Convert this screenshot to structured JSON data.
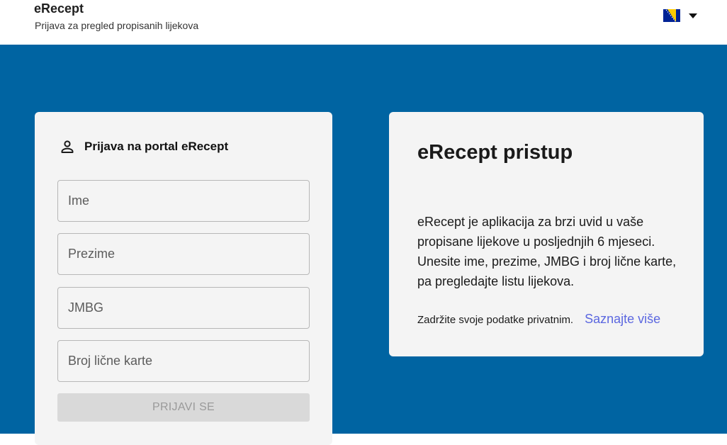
{
  "header": {
    "app_title": "eRecept",
    "subtitle": "Prijava za pregled propisanih lijekova"
  },
  "language_select": {
    "flag_icon": "bosnia-herzegovina-flag-icon",
    "colors": {
      "flag_blue": "#002395",
      "flag_yellow": "#fecb00"
    }
  },
  "login": {
    "title": "Prijava na portal eRecept",
    "icon": "person-icon",
    "fields": {
      "first_name_placeholder": "Ime",
      "last_name_placeholder": "Prezime",
      "jmbg_placeholder": "JMBG",
      "id_card_placeholder": "Broj lične karte"
    },
    "submit_label": "PRIJAVI SE"
  },
  "info": {
    "title": "eRecept pristup",
    "body": "eRecept je aplikacija za brzi uvid u vaše propisane lijekove u posljednjih 6 mjeseci. Unesite ime, prezime, JMBG i broj lične karte, pa pregledajte listu lijekova.",
    "privacy_text": "Zadržite svoje podatke privatnim.",
    "learn_more_label": "Saznajte više"
  },
  "colors": {
    "background_blue": "#0064a2",
    "card": "#f4f4f4",
    "link": "#5b67e0",
    "disabled_button": "#d9d9d9"
  }
}
